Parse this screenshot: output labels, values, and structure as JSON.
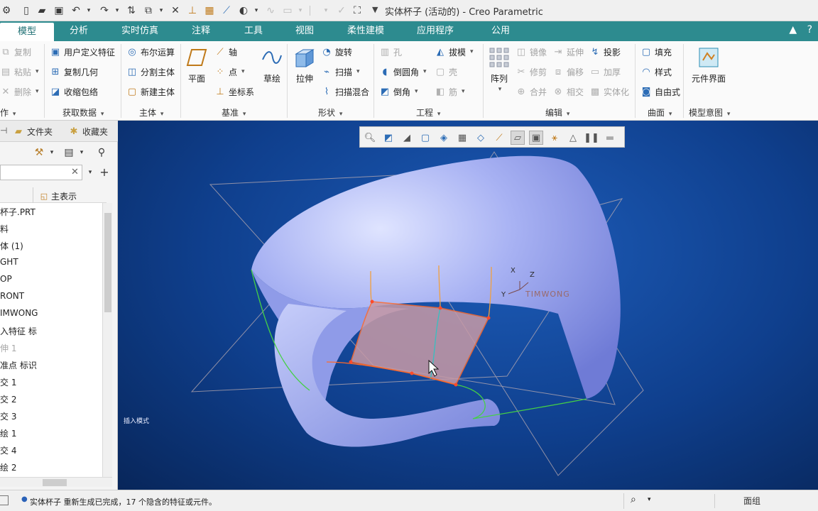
{
  "window": {
    "title": "实体杯子 (活动的) - Creo Parametric"
  },
  "tabs": [
    {
      "label": "模型",
      "active": true
    },
    {
      "label": "分析"
    },
    {
      "label": "实时仿真"
    },
    {
      "label": "注释"
    },
    {
      "label": "工具"
    },
    {
      "label": "视图"
    },
    {
      "label": "柔性建模"
    },
    {
      "label": "应用程序"
    },
    {
      "label": "公用"
    }
  ],
  "ribbon": {
    "operations": {
      "copy": "复制",
      "paste": "粘贴",
      "delete": "删除",
      "group": "作"
    },
    "get_data": {
      "udf": "用户定义特征",
      "copy_geom": "复制几何",
      "shrinkwrap": "收缩包络",
      "group": "获取数据"
    },
    "body": {
      "boolean": "布尔运算",
      "split": "分割主体",
      "new_body": "新建主体",
      "group": "主体"
    },
    "datum": {
      "plane": "平面",
      "axis": "轴",
      "point": "点",
      "csys": "坐标系",
      "sketch": "草绘",
      "group": "基准"
    },
    "shapes": {
      "extrude": "拉伸",
      "revolve": "旋转",
      "sweep": "扫描",
      "swept_blend": "扫描混合",
      "group": "形状"
    },
    "engineering": {
      "hole": "孔",
      "round": "倒圆角",
      "chamfer": "倒角",
      "draft": "拔模",
      "shell": "壳",
      "rib": "筋",
      "group": "工程"
    },
    "editing": {
      "pattern": "阵列",
      "mirror": "镜像",
      "extend": "延伸",
      "project": "投影",
      "trim": "修剪",
      "offset": "偏移",
      "thicken": "加厚",
      "merge": "合并",
      "intersect": "相交",
      "solidify": "实体化",
      "group": "编辑"
    },
    "surfaces": {
      "fill": "填充",
      "style": "样式",
      "freestyle": "自由式",
      "group": "曲面"
    },
    "intent": {
      "component_interface": "元件界面",
      "group": "模型意图"
    }
  },
  "navigator": {
    "tabs": [
      "文件夹",
      "收藏夹"
    ],
    "header_label": "主表示",
    "tree": [
      {
        "label": "杯子.PRT"
      },
      {
        "label": "料"
      },
      {
        "label": "体 (1)"
      },
      {
        "label": "GHT"
      },
      {
        "label": "OP"
      },
      {
        "label": "RONT"
      },
      {
        "label": "IMWONG"
      },
      {
        "label": "入特征 标"
      },
      {
        "label": "伸 1",
        "disabled": true
      },
      {
        "label": "准点 标识"
      },
      {
        "label": "交 1"
      },
      {
        "label": "交 2"
      },
      {
        "label": "交 3"
      },
      {
        "label": "绘 1"
      },
      {
        "label": "交 4"
      },
      {
        "label": "绘 2"
      }
    ]
  },
  "viewport": {
    "mode_label": "插入模式",
    "csys": {
      "x": "X",
      "y": "Y",
      "z": "Z",
      "name": "TIMWONG"
    }
  },
  "status": {
    "message": "实体杯子 重新生成已完成，17 个隐含的特征或元件。",
    "filter": "面组"
  },
  "colors": {
    "ribbon_tab_bg": "#2d8b8f",
    "viewport_bg": "#0f3f8d",
    "model": "#9aa6ef",
    "highlight": "#ff6a2a"
  }
}
